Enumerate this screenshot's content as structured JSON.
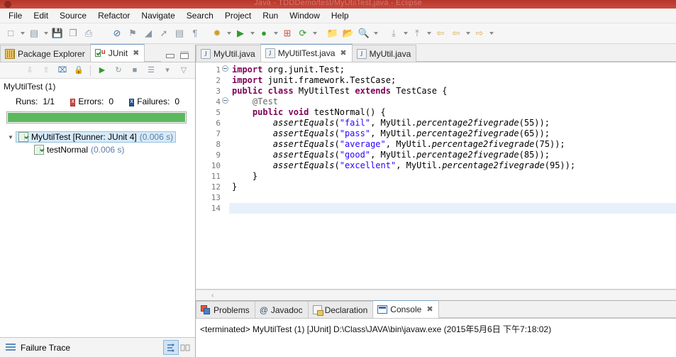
{
  "window": {
    "title": "Java - TDDDemo/test/MyUtilTest.java - Eclipse",
    "title_color": "#c0392b"
  },
  "menu": {
    "items": [
      {
        "label": "File"
      },
      {
        "label": "Edit"
      },
      {
        "label": "Source"
      },
      {
        "label": "Refactor"
      },
      {
        "label": "Navigate"
      },
      {
        "label": "Search"
      },
      {
        "label": "Project"
      },
      {
        "label": "Run"
      },
      {
        "label": "Window"
      },
      {
        "label": "Help"
      }
    ]
  },
  "toolbar": {
    "buttons": [
      {
        "name": "new-icon",
        "glyph": "□"
      },
      {
        "name": "new-dropdown-icon",
        "glyph": "▾"
      },
      {
        "name": "new-java-class-icon",
        "glyph": "▤"
      },
      {
        "name": "new-java-class-dropdown-icon",
        "glyph": "▾"
      },
      {
        "name": "save-icon",
        "glyph": "💾"
      },
      {
        "name": "save-all-icon",
        "glyph": "❐"
      },
      {
        "name": "print-icon",
        "glyph": "⎙"
      },
      {
        "name": "toggle-breakpoint-icon",
        "glyph": "⊘"
      },
      {
        "name": "skip-breakpoints-icon",
        "glyph": "⚑"
      },
      {
        "name": "new-annotation-icon",
        "glyph": "◢"
      },
      {
        "name": "quick-access-icon",
        "glyph": "➚"
      },
      {
        "name": "open-type-icon",
        "glyph": "▤"
      },
      {
        "name": "open-task-icon",
        "glyph": "¶"
      },
      {
        "name": "debug-icon",
        "glyph": "✹"
      },
      {
        "name": "debug-dropdown-icon",
        "glyph": "▾"
      },
      {
        "name": "run-icon",
        "glyph": "▶"
      },
      {
        "name": "run-dropdown-icon",
        "glyph": "▾"
      },
      {
        "name": "run-coverage-icon",
        "glyph": "●"
      },
      {
        "name": "run-coverage-dropdown-icon",
        "glyph": "▾"
      },
      {
        "name": "new-package-icon",
        "glyph": "⊞"
      },
      {
        "name": "external-tools-icon",
        "glyph": "⟳"
      },
      {
        "name": "external-tools-dropdown-icon",
        "glyph": "▾"
      },
      {
        "name": "open-resource-icon",
        "glyph": "📁"
      },
      {
        "name": "open-folder-icon",
        "glyph": "📂"
      },
      {
        "name": "search-icon",
        "glyph": "🔍"
      },
      {
        "name": "search-dropdown-icon",
        "glyph": "▾"
      },
      {
        "name": "next-annotation-icon",
        "glyph": "⤓"
      },
      {
        "name": "next-annotation-dropdown-icon",
        "glyph": "▾"
      },
      {
        "name": "previous-annotation-icon",
        "glyph": "⤒"
      },
      {
        "name": "previous-annotation-dropdown-icon",
        "glyph": "▾"
      },
      {
        "name": "back-history-icon",
        "glyph": "⇦"
      },
      {
        "name": "back-icon",
        "glyph": "⇦"
      },
      {
        "name": "back-dropdown-icon",
        "glyph": "▾"
      },
      {
        "name": "forward-icon",
        "glyph": "⇨"
      },
      {
        "name": "forward-dropdown-icon",
        "glyph": "▾"
      }
    ]
  },
  "left_panel": {
    "tabs": [
      {
        "label": "Package Explorer",
        "icon": "package-explorer-icon",
        "active": false,
        "closable": false
      },
      {
        "label": "JUnit",
        "icon": "junit-icon",
        "active": true,
        "closable": true
      }
    ],
    "view_buttons": [
      {
        "name": "minimize-view-button",
        "title": "Minimize"
      },
      {
        "name": "maximize-view-button",
        "title": "Maximize"
      }
    ],
    "junit_toolbar": [
      {
        "name": "next-failure-icon",
        "glyph": "⇩"
      },
      {
        "name": "previous-failure-icon",
        "glyph": "⇧"
      },
      {
        "name": "export-test-run-icon",
        "glyph": "⌧"
      },
      {
        "name": "lock-history-icon",
        "glyph": "🔒"
      },
      {
        "name": "rerun-test-icon",
        "glyph": "▶"
      },
      {
        "name": "rerun-failed-tests-icon",
        "glyph": "↻"
      },
      {
        "name": "stop-test-icon",
        "glyph": "■"
      },
      {
        "name": "test-run-history-icon",
        "glyph": "☰"
      },
      {
        "name": "view-menu-dropdown-icon",
        "glyph": "▾"
      },
      {
        "name": "view-minimize-icon",
        "glyph": "▽"
      }
    ],
    "junit": {
      "title": "MyUtilTest (1)",
      "runs_label": "Runs:",
      "runs_value": "1/1",
      "errors_label": "Errors:",
      "errors_value": "0",
      "failures_label": "Failures:",
      "failures_value": "0",
      "progress_percent": 100,
      "progress_color": "#5cb85c",
      "tree": [
        {
          "label": "MyUtilTest [Runner: JUnit 4]",
          "time": "(0.006 s)",
          "selected": true,
          "expanded": true,
          "depth": 0,
          "icon": "junit-test-class-icon"
        },
        {
          "label": "testNormal",
          "time": "(0.006 s)",
          "selected": false,
          "expanded": false,
          "depth": 1,
          "icon": "junit-test-method-icon"
        }
      ]
    },
    "failure_trace": {
      "title": "Failure Trace",
      "icon": "failure-trace-icon",
      "buttons": [
        {
          "name": "filter-stack-trace-button",
          "glyph": "⇥",
          "pressed": true
        },
        {
          "name": "compare-result-button",
          "glyph": "↔",
          "pressed": false
        }
      ]
    }
  },
  "editor": {
    "tabs": [
      {
        "label": "MyUtil.java",
        "icon": "java-file-icon",
        "active": false,
        "closable": false
      },
      {
        "label": "MyUtilTest.java",
        "icon": "java-file-icon",
        "active": true,
        "closable": true
      },
      {
        "label": "MyUtil.java",
        "icon": "java-file-icon",
        "active": false,
        "closable": false
      }
    ],
    "scroll_left_icon": "‹",
    "current_line": 14,
    "lines": [
      {
        "n": 1,
        "fold": true,
        "tokens": [
          {
            "t": "import",
            "c": "kw"
          },
          {
            "t": " org.junit.Test;",
            "c": ""
          }
        ]
      },
      {
        "n": 2,
        "fold": false,
        "tokens": [
          {
            "t": "import",
            "c": "kw"
          },
          {
            "t": " junit.framework.TestCase;",
            "c": ""
          }
        ]
      },
      {
        "n": 3,
        "fold": false,
        "tokens": [
          {
            "t": "public class",
            "c": "kw"
          },
          {
            "t": " MyUtilTest ",
            "c": ""
          },
          {
            "t": "extends",
            "c": "kw"
          },
          {
            "t": " TestCase {",
            "c": ""
          }
        ]
      },
      {
        "n": 4,
        "fold": true,
        "tokens": [
          {
            "t": "    @Test",
            "c": "ann"
          }
        ]
      },
      {
        "n": 5,
        "fold": false,
        "tokens": [
          {
            "t": "    ",
            "c": ""
          },
          {
            "t": "public void",
            "c": "kw"
          },
          {
            "t": " testNormal() {",
            "c": ""
          }
        ]
      },
      {
        "n": 6,
        "fold": false,
        "tokens": [
          {
            "t": "        ",
            "c": ""
          },
          {
            "t": "assertEquals",
            "c": "mth"
          },
          {
            "t": "(",
            "c": ""
          },
          {
            "t": "\"fail\"",
            "c": "str"
          },
          {
            "t": ", MyUtil.",
            "c": ""
          },
          {
            "t": "percentage2fivegrade",
            "c": "mth"
          },
          {
            "t": "(55));",
            "c": ""
          }
        ]
      },
      {
        "n": 7,
        "fold": false,
        "tokens": [
          {
            "t": "        ",
            "c": ""
          },
          {
            "t": "assertEquals",
            "c": "mth"
          },
          {
            "t": "(",
            "c": ""
          },
          {
            "t": "\"pass\"",
            "c": "str"
          },
          {
            "t": ", MyUtil.",
            "c": ""
          },
          {
            "t": "percentage2fivegrade",
            "c": "mth"
          },
          {
            "t": "(65));",
            "c": ""
          }
        ]
      },
      {
        "n": 8,
        "fold": false,
        "tokens": [
          {
            "t": "        ",
            "c": ""
          },
          {
            "t": "assertEquals",
            "c": "mth"
          },
          {
            "t": "(",
            "c": ""
          },
          {
            "t": "\"average\"",
            "c": "str"
          },
          {
            "t": ", MyUtil.",
            "c": ""
          },
          {
            "t": "percentage2fivegrade",
            "c": "mth"
          },
          {
            "t": "(75));",
            "c": ""
          }
        ]
      },
      {
        "n": 9,
        "fold": false,
        "tokens": [
          {
            "t": "        ",
            "c": ""
          },
          {
            "t": "assertEquals",
            "c": "mth"
          },
          {
            "t": "(",
            "c": ""
          },
          {
            "t": "\"good\"",
            "c": "str"
          },
          {
            "t": ", MyUtil.",
            "c": ""
          },
          {
            "t": "percentage2fivegrade",
            "c": "mth"
          },
          {
            "t": "(85));",
            "c": ""
          }
        ]
      },
      {
        "n": 10,
        "fold": false,
        "tokens": [
          {
            "t": "        ",
            "c": ""
          },
          {
            "t": "assertEquals",
            "c": "mth"
          },
          {
            "t": "(",
            "c": ""
          },
          {
            "t": "\"excellent\"",
            "c": "str"
          },
          {
            "t": ", MyUtil.",
            "c": ""
          },
          {
            "t": "percentage2fivegrade",
            "c": "mth"
          },
          {
            "t": "(95));",
            "c": ""
          }
        ]
      },
      {
        "n": 11,
        "fold": false,
        "tokens": [
          {
            "t": "    }",
            "c": ""
          }
        ]
      },
      {
        "n": 12,
        "fold": false,
        "tokens": [
          {
            "t": "}",
            "c": ""
          }
        ]
      },
      {
        "n": 13,
        "fold": false,
        "tokens": [
          {
            "t": "",
            "c": ""
          }
        ]
      },
      {
        "n": 14,
        "fold": false,
        "tokens": [
          {
            "t": "",
            "c": ""
          }
        ]
      }
    ]
  },
  "bottom_panel": {
    "tabs": [
      {
        "label": "Problems",
        "icon": "problems-icon",
        "active": false,
        "closable": false
      },
      {
        "label": "Javadoc",
        "icon": "javadoc-icon",
        "active": false,
        "closable": false
      },
      {
        "label": "Declaration",
        "icon": "declaration-icon",
        "active": false,
        "closable": false
      },
      {
        "label": "Console",
        "icon": "console-icon",
        "active": true,
        "closable": true
      }
    ],
    "console_text": "<terminated> MyUtilTest (1) [JUnit] D:\\Class\\JAVA\\bin\\javaw.exe (2015年5月6日 下午7:18:02)"
  }
}
